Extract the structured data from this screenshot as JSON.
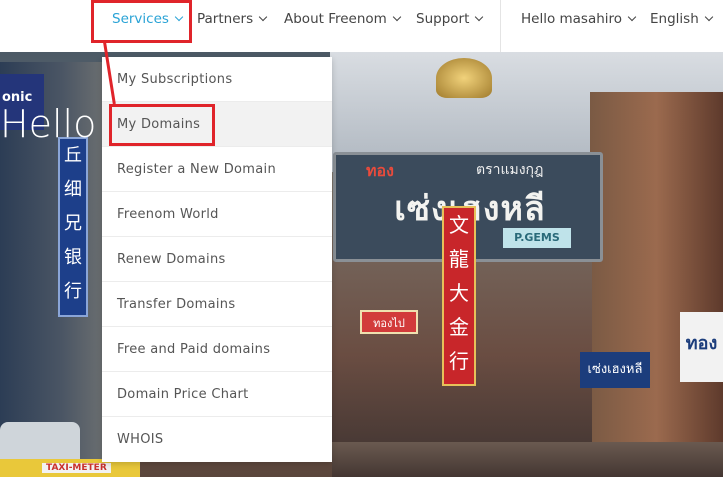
{
  "nav": {
    "items": [
      {
        "label": "Services",
        "active": true
      },
      {
        "label": "Partners"
      },
      {
        "label": "About Freenom"
      },
      {
        "label": "Support"
      }
    ],
    "user_greeting": "Hello masahiro",
    "language": "English"
  },
  "hero": {
    "heading": "Hello",
    "sign_left": "onic",
    "sign_main_top_left": "ทอง",
    "sign_main_top_right": "ตราแมงกุฎ",
    "sign_main_text": "เซ่งเฮงหลี",
    "vertical_sign": [
      "文",
      "龍",
      "大",
      "金",
      "行"
    ],
    "vertical_sign_left": [
      "丘",
      "细",
      "兄",
      "银",
      "行"
    ],
    "small_sign": "P.GEMS",
    "sign_ilong": "ทองไป",
    "sign_blue": "เซ่งเฮงหลี",
    "sign_right": "ทอง",
    "taxi_label": "TAXI-METER"
  },
  "dropdown": {
    "items": [
      {
        "label": "My Subscriptions"
      },
      {
        "label": "My Domains",
        "highlighted": true
      },
      {
        "label": "Register a New Domain"
      },
      {
        "label": "Freenom World"
      },
      {
        "label": "Renew Domains"
      },
      {
        "label": "Transfer Domains"
      },
      {
        "label": "Free and Paid domains"
      },
      {
        "label": "Domain Price Chart"
      },
      {
        "label": "WHOIS"
      }
    ]
  },
  "colors": {
    "accent": "#2aa3d6",
    "annotation": "#e0242a",
    "nav_text": "#444444"
  }
}
